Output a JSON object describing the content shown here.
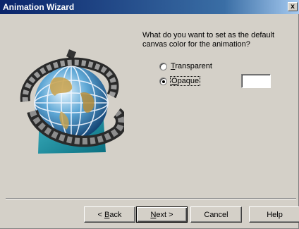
{
  "window": {
    "title": "Animation Wizard",
    "close_glyph": "x"
  },
  "question": "What do you want to set as the default canvas color for the animation?",
  "options": [
    {
      "label_pre": "",
      "label_key": "T",
      "label_post": "ransparent",
      "selected": false
    },
    {
      "label_pre": "",
      "label_key": "O",
      "label_post": "paque",
      "selected": true
    }
  ],
  "color_swatch": "#ffffff",
  "buttons": {
    "back": {
      "pre": "< ",
      "key": "B",
      "post": "ack"
    },
    "next": {
      "pre": "",
      "key": "N",
      "post": "ext >"
    },
    "cancel": "Cancel",
    "help": "Help"
  },
  "illustration": {
    "icon": "globe-with-film-strip-icon"
  }
}
